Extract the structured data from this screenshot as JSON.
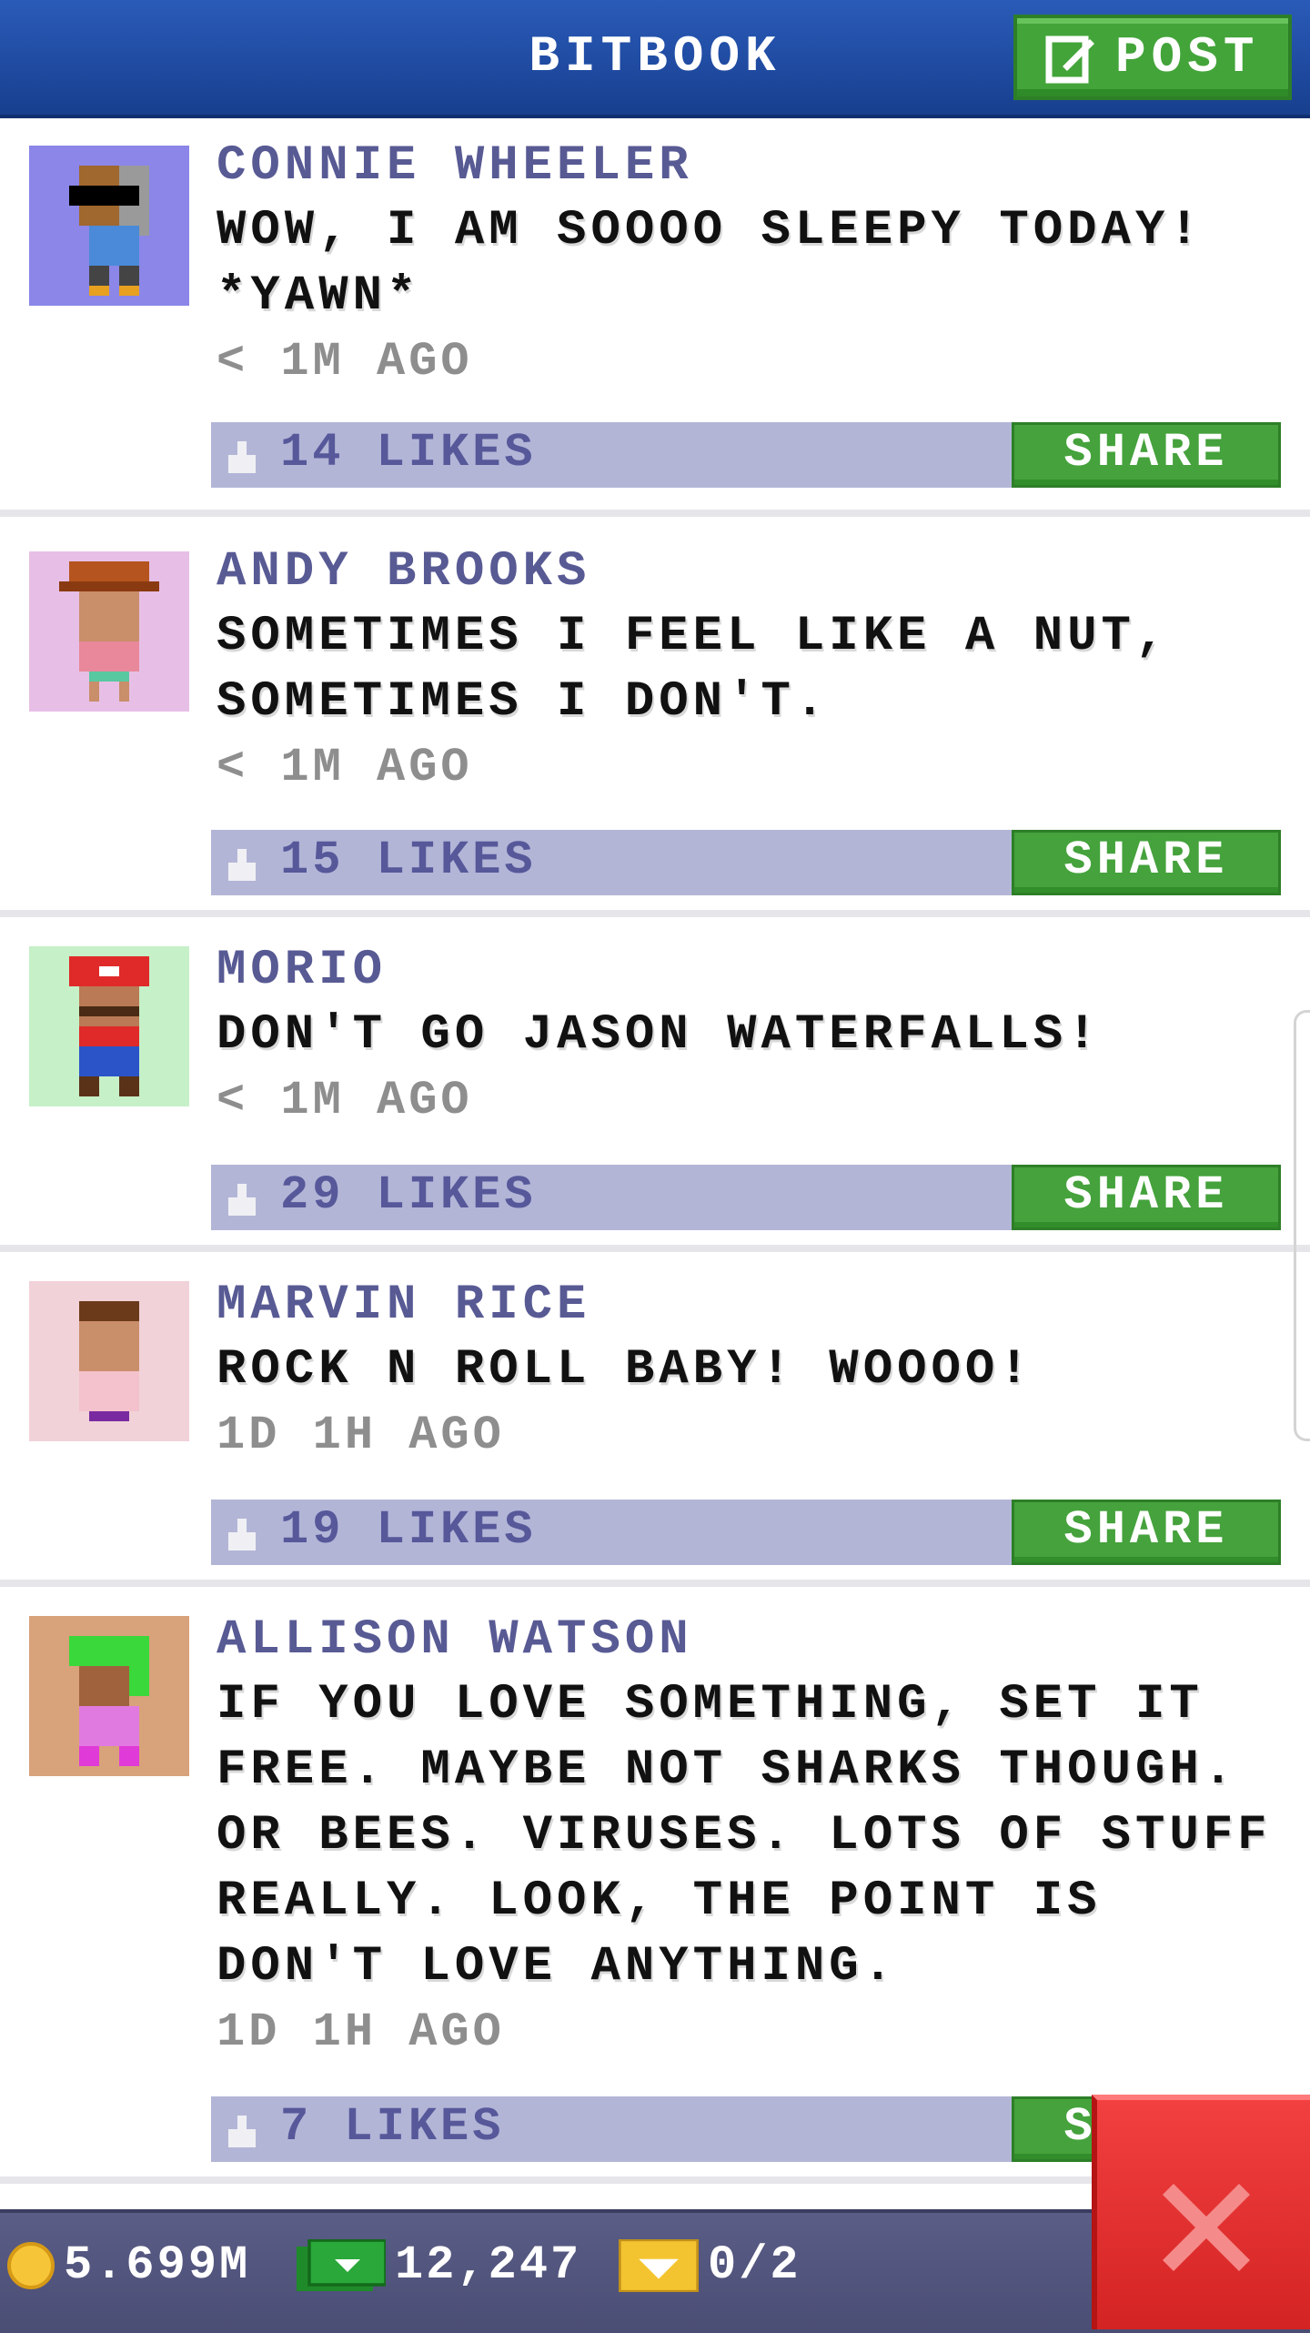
{
  "header": {
    "title": "BITBOOK",
    "post_label": "POST"
  },
  "posts": [
    {
      "name": "CONNIE WHEELER",
      "text": "WOW, I AM SOOOO SLEEPY TODAY! *YAWN*",
      "time": "< 1M AGO",
      "likes": "14 LIKES",
      "share": "SHARE",
      "avatar_bg": "#8b86e8"
    },
    {
      "name": "ANDY BROOKS",
      "text": "SOMETIMES I FEEL LIKE A NUT, SOMETIMES I DON'T.",
      "time": "< 1M AGO",
      "likes": "15 LIKES",
      "share": "SHARE",
      "avatar_bg": "#e7bfe6"
    },
    {
      "name": "MORIO",
      "text": "DON'T GO JASON WATERFALLS!",
      "time": "< 1M AGO",
      "likes": "29 LIKES",
      "share": "SHARE",
      "avatar_bg": "#c6f0c8"
    },
    {
      "name": "MARVIN RICE",
      "text": "ROCK N ROLL BABY! WOOOO!",
      "time": "1D 1H AGO",
      "likes": "19 LIKES",
      "share": "SHARE",
      "avatar_bg": "#f1d2d8"
    },
    {
      "name": "ALLISON WATSON",
      "text": "IF YOU LOVE SOMETHING, SET IT FREE. MAYBE NOT SHARKS THOUGH. OR BEES. VIRUSES. LOTS OF STUFF REALLY. LOOK, THE POINT IS DON'T LOVE ANYTHING.",
      "time": "1D 1H AGO",
      "likes": "7 LIKES",
      "share": "SHARE",
      "avatar_bg": "#d8a27a"
    }
  ],
  "status_bar": {
    "coins": "5.699M",
    "bux": "12,247",
    "tickets": "0/2"
  },
  "colors": {
    "header": "#1f4aa0",
    "share_green": "#45a23c",
    "like_bar": "#b3b5d7",
    "close_red": "#e03030"
  }
}
